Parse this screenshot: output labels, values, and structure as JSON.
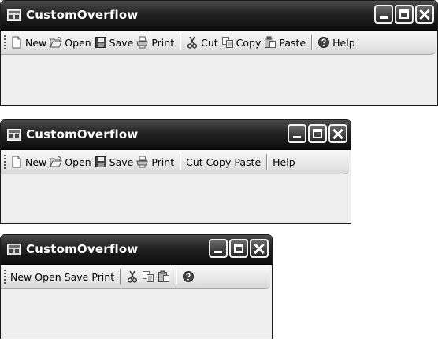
{
  "windows": [
    {
      "title": "CustomOverflow",
      "toolbar": [
        {
          "type": "button",
          "icon": "new-icon",
          "label": "New"
        },
        {
          "type": "button",
          "icon": "open-icon",
          "label": "Open"
        },
        {
          "type": "button",
          "icon": "save-icon",
          "label": "Save"
        },
        {
          "type": "button",
          "icon": "print-icon",
          "label": "Print"
        },
        {
          "type": "separator"
        },
        {
          "type": "button",
          "icon": "cut-icon",
          "label": "Cut"
        },
        {
          "type": "button",
          "icon": "copy-icon",
          "label": "Copy"
        },
        {
          "type": "button",
          "icon": "paste-icon",
          "label": "Paste"
        },
        {
          "type": "separator"
        },
        {
          "type": "button",
          "icon": "help-icon",
          "label": "Help"
        }
      ]
    },
    {
      "title": "CustomOverflow",
      "toolbar": [
        {
          "type": "button",
          "icon": "new-icon",
          "label": "New"
        },
        {
          "type": "button",
          "icon": "open-icon",
          "label": "Open"
        },
        {
          "type": "button",
          "icon": "save-icon",
          "label": "Save"
        },
        {
          "type": "button",
          "icon": "print-icon",
          "label": "Print"
        },
        {
          "type": "separator"
        },
        {
          "type": "button",
          "icon": "",
          "label": "Cut"
        },
        {
          "type": "button",
          "icon": "",
          "label": "Copy"
        },
        {
          "type": "button",
          "icon": "",
          "label": "Paste"
        },
        {
          "type": "separator"
        },
        {
          "type": "button",
          "icon": "",
          "label": "Help"
        }
      ]
    },
    {
      "title": "CustomOverflow",
      "toolbar": [
        {
          "type": "button",
          "icon": "",
          "label": "New"
        },
        {
          "type": "button",
          "icon": "",
          "label": "Open"
        },
        {
          "type": "button",
          "icon": "",
          "label": "Save"
        },
        {
          "type": "button",
          "icon": "",
          "label": "Print"
        },
        {
          "type": "separator"
        },
        {
          "type": "button",
          "icon": "cut-icon",
          "label": ""
        },
        {
          "type": "button",
          "icon": "copy-icon",
          "label": ""
        },
        {
          "type": "button",
          "icon": "paste-icon",
          "label": ""
        },
        {
          "type": "separator"
        },
        {
          "type": "button",
          "icon": "help-icon",
          "label": ""
        }
      ]
    }
  ]
}
